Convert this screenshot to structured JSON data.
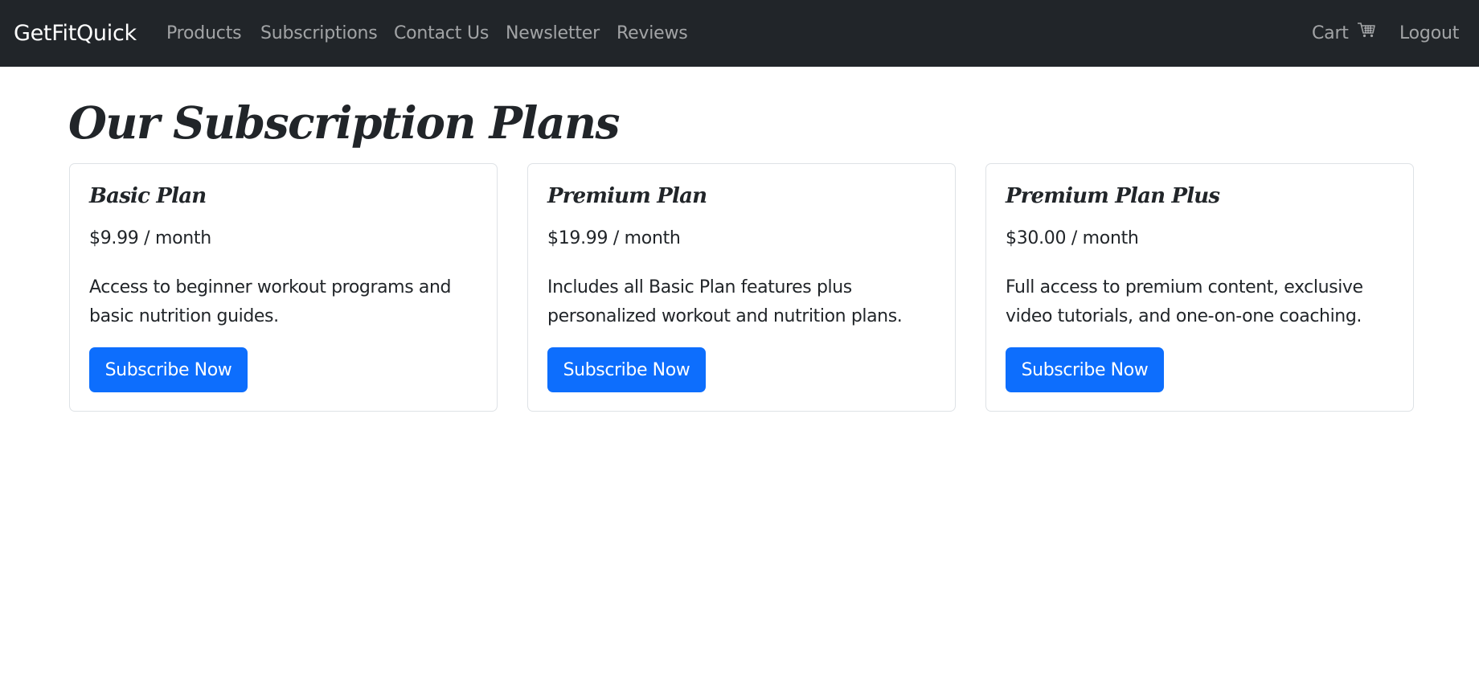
{
  "navbar": {
    "brand": "GetFitQuick",
    "links": [
      "Products",
      "Subscriptions",
      "Contact Us",
      "Newsletter",
      "Reviews"
    ],
    "cart_label": "Cart",
    "cart_icon": "cart-icon",
    "logout_label": "Logout"
  },
  "main": {
    "title": "Our Subscription Plans",
    "plans": [
      {
        "name": "Basic Plan",
        "price": "$9.99 / month",
        "description": "Access to beginner workout programs and basic nutrition guides.",
        "button": "Subscribe Now"
      },
      {
        "name": "Premium Plan",
        "price": "$19.99 / month",
        "description": "Includes all Basic Plan features plus personalized workout and nutrition plans.",
        "button": "Subscribe Now"
      },
      {
        "name": "Premium Plan Plus",
        "price": "$30.00 / month",
        "description": "Full access to premium content, exclusive video tutorials, and one-on-one coaching.",
        "button": "Subscribe Now"
      }
    ]
  },
  "colors": {
    "navbar_bg": "#212529",
    "primary": "#0d6efd",
    "text": "#212529",
    "border": "#dee2e6"
  }
}
